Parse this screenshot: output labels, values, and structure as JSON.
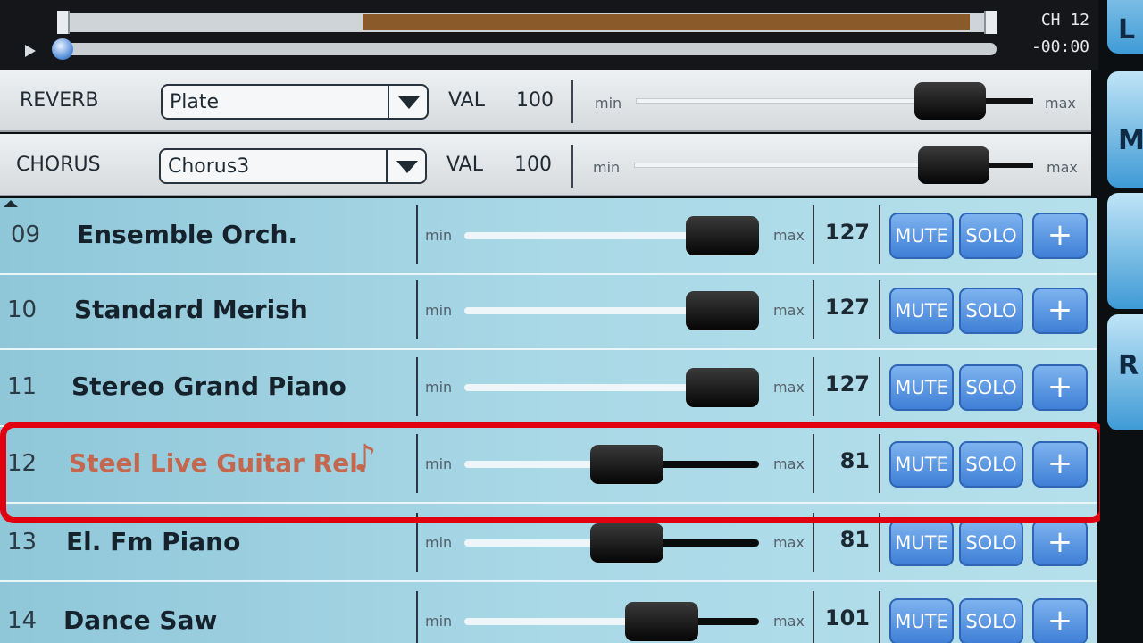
{
  "transport": {
    "channel_label": "CH 12",
    "time_label": "-00:00"
  },
  "effects": [
    {
      "label": "REVERB",
      "type": "Plate",
      "val_label": "VAL",
      "value": "100",
      "min_label": "min",
      "max_label": "max",
      "level": 0.72
    },
    {
      "label": "CHORUS",
      "type": "Chorus3",
      "val_label": "VAL",
      "value": "100",
      "min_label": "min",
      "max_label": "max",
      "level": 0.73
    }
  ],
  "channels": [
    {
      "number": "09",
      "name": "Ensemble Orch.",
      "value": "127",
      "level": 1.0,
      "active": false
    },
    {
      "number": "10",
      "name": "Standard Merish",
      "value": "127",
      "level": 1.0,
      "active": false
    },
    {
      "number": "11",
      "name": "Stereo Grand Piano",
      "value": "127",
      "level": 1.0,
      "active": false
    },
    {
      "number": "12",
      "name": "Steel Live Guitar Rel.",
      "value": "81",
      "level": 0.64,
      "active": true
    },
    {
      "number": "13",
      "name": "El. Fm Piano",
      "value": "81",
      "level": 0.64,
      "active": false
    },
    {
      "number": "14",
      "name": "Dance Saw",
      "value": "101",
      "level": 0.8,
      "active": false
    }
  ],
  "channel_controls": {
    "min_label": "min",
    "max_label": "max",
    "mute_label": "MUTE",
    "solo_label": "SOLO",
    "plus_label": "+"
  },
  "side_tabs": [
    "L",
    "M",
    "",
    "R"
  ],
  "colors": {
    "active_name": "#c3684e",
    "highlight_border": "#e00010",
    "button_blue": "#3f7fd6",
    "progress_brown": "#8a5a2a"
  }
}
